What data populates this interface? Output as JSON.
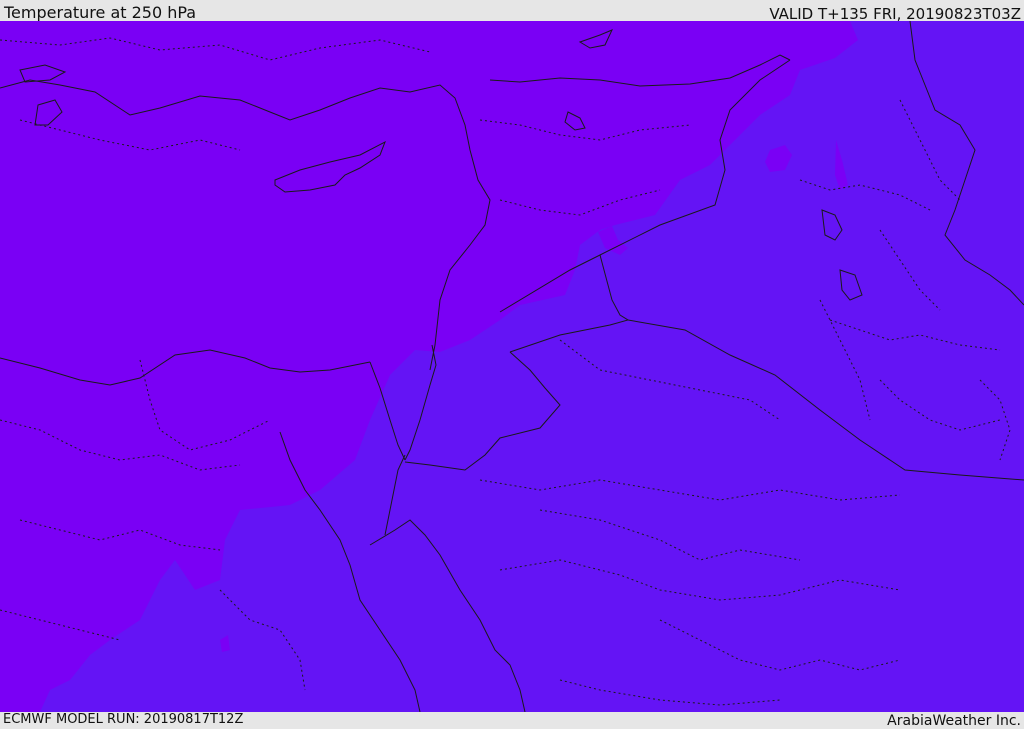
{
  "header": {
    "title": "Temperature at 250 hPa",
    "valid": "VALID T+135 FRI, 20190823T03Z"
  },
  "footer": {
    "model_run": "ECMWF MODEL RUN: 20190817T12Z",
    "credit": "ArabiaWeather Inc."
  },
  "map": {
    "colors": {
      "warm_zone": "#7a00f5",
      "cool_zone": "#6414f5",
      "borders": "#1a1a1a"
    }
  }
}
